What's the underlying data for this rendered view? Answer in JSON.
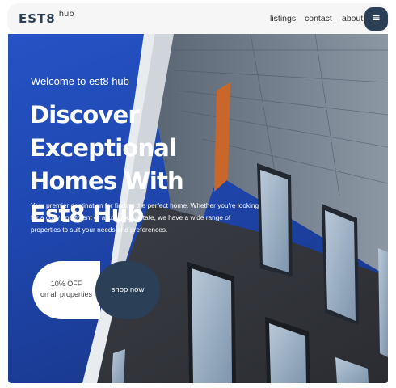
{
  "header": {
    "logo_main": "EST8",
    "logo_sub": "hub",
    "nav": [
      "listings",
      "contact",
      "about"
    ],
    "menu_icon": "hamburger-icon"
  },
  "hero": {
    "welcome": "Welcome to est8 hub",
    "headline": "Discover Exceptional Homes With Est8 Hub",
    "description": "Your premier destination for finding the perfect home. Whether you're looking for a cozy apartment or a luxurious estate, we have a wide range of properties to suit your needs and preferences.",
    "promo_line1": "10% OFF",
    "promo_line2": "on all properties",
    "cta_label": "shop now"
  },
  "colors": {
    "primary": "#2b3f57",
    "sky": "#1f47b0",
    "text_light": "#ffffff"
  }
}
